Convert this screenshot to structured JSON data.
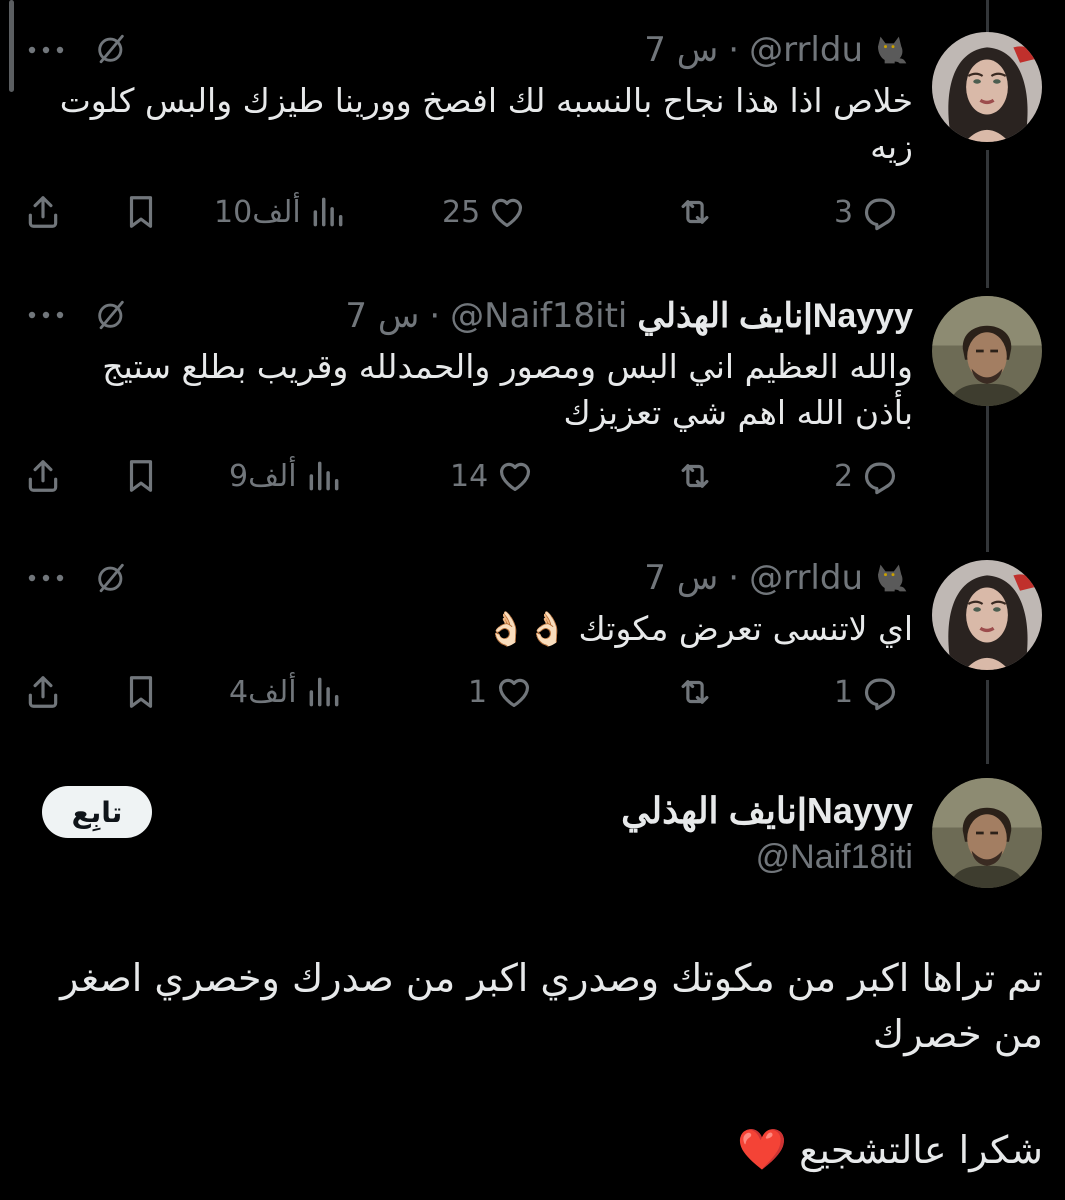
{
  "replies": [
    {
      "name": "",
      "handle": "@rrldu",
      "time": "7 س",
      "text": "خلاص اذا هذا نجاح بالنسبه لك افصخ وورينا طيزك والبس كلوت زيه",
      "stats": {
        "replies": "3",
        "likes": "25",
        "views": "10ألف"
      },
      "avatar": "woman-avatar"
    },
    {
      "name": "نايف الهذلي|Nayyy",
      "handle": "@Naif18iti",
      "time": "7 س",
      "text": "والله العظيم اني البس ومصور والحمدلله وقريب بطلع ستيج بأذن الله اهم شي تعزيزك",
      "stats": {
        "replies": "2",
        "likes": "14",
        "views": "9ألف"
      },
      "avatar": "man-avatar"
    },
    {
      "name": "",
      "handle": "@rrldu",
      "time": "7 س",
      "text": "اي لاتنسى تعرض مكوتك 👌🏻👌🏻",
      "stats": {
        "replies": "1",
        "likes": "1",
        "views": "4ألف"
      },
      "avatar": "woman-avatar"
    }
  ],
  "main_post": {
    "name": "نايف الهذلي|Nayyy",
    "handle": "@Naif18iti",
    "follow_label": "تابِع",
    "text_1": "تم تراها اكبر من مكوتك وصدري اكبر من صدرك وخصري اصغر من خصرك",
    "text_2": "شكرا عالتشجيع",
    "heart": "❤️"
  },
  "icons": [
    "more-icon",
    "grok-icon",
    "share-icon",
    "bookmark-icon",
    "views-icon",
    "like-icon",
    "retweet-icon",
    "reply-icon",
    "cat-icon"
  ],
  "colors": {
    "background": "#000000",
    "text": "#e7e9ea",
    "secondary": "#71767b",
    "thread_line": "#333639",
    "follow_button": "#eff3f4"
  }
}
